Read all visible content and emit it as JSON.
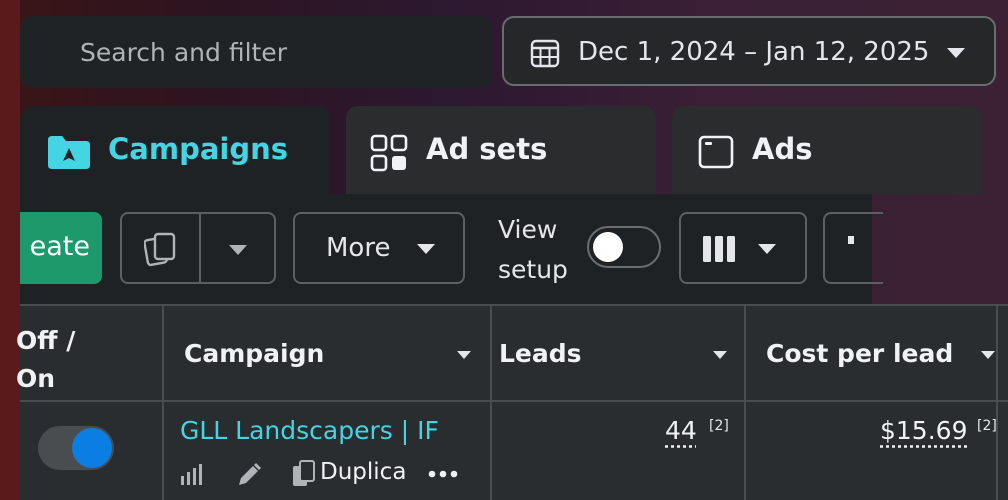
{
  "search": {
    "placeholder": "Search and filter"
  },
  "date_range": {
    "label": "Dec 1, 2024 – Jan 12, 2025"
  },
  "tabs": [
    {
      "label": "Campaigns",
      "active": true,
      "icon": "folder-campaign-icon"
    },
    {
      "label": "Ad sets",
      "active": false,
      "icon": "grid-icon"
    },
    {
      "label": "Ads",
      "active": false,
      "icon": "ad-window-icon"
    }
  ],
  "toolbar": {
    "create_label": "eate",
    "more_label": "More",
    "view_setup_line1": "View",
    "view_setup_line2": "setup",
    "view_setup_on": false
  },
  "table": {
    "headers": {
      "toggle": {
        "line1": "Off /",
        "line2": "On"
      },
      "campaign": "Campaign",
      "leads": "Leads",
      "cost_per_lead": "Cost per lead"
    },
    "rows": [
      {
        "on": true,
        "campaign_name": "GLL Landscapers | IF",
        "duplicate_label": "Duplica",
        "leads": "44",
        "leads_ref": "[2]",
        "cost_per_lead": "$15.69",
        "cost_ref": "[2]"
      }
    ]
  },
  "colors": {
    "accent": "#45d4e3",
    "create_button": "#1d9a6c",
    "toggle_on": "#0b7ee3"
  }
}
